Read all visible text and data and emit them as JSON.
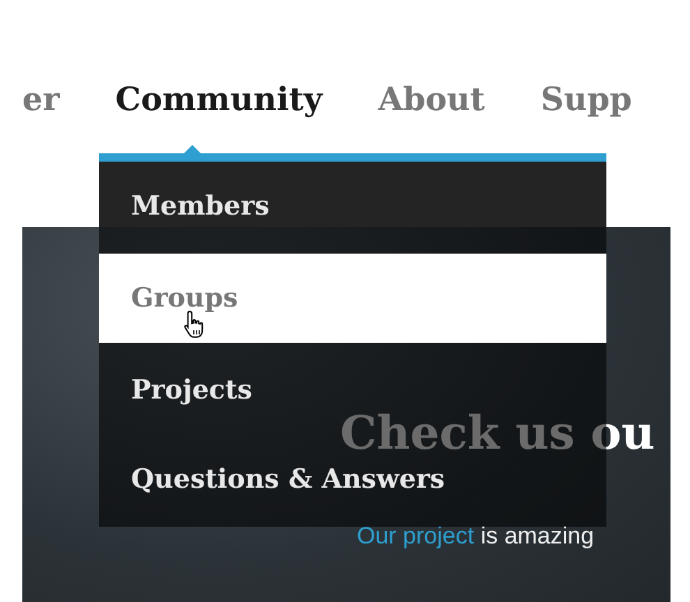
{
  "nav": {
    "items": [
      {
        "label": "er",
        "selected": false
      },
      {
        "label": "Community",
        "selected": true
      },
      {
        "label": "About",
        "selected": false
      },
      {
        "label": "Supp",
        "selected": false
      }
    ]
  },
  "dropdown": {
    "items": [
      {
        "label": "Members",
        "selected": false
      },
      {
        "label": "Groups",
        "selected": true
      },
      {
        "label": "Projects",
        "selected": false
      },
      {
        "label": "Questions & Answers",
        "selected": false
      }
    ]
  },
  "hero": {
    "heading_dim": "Check us",
    "heading_bright": "ou",
    "link": "Our project",
    "text": "is amazing"
  }
}
